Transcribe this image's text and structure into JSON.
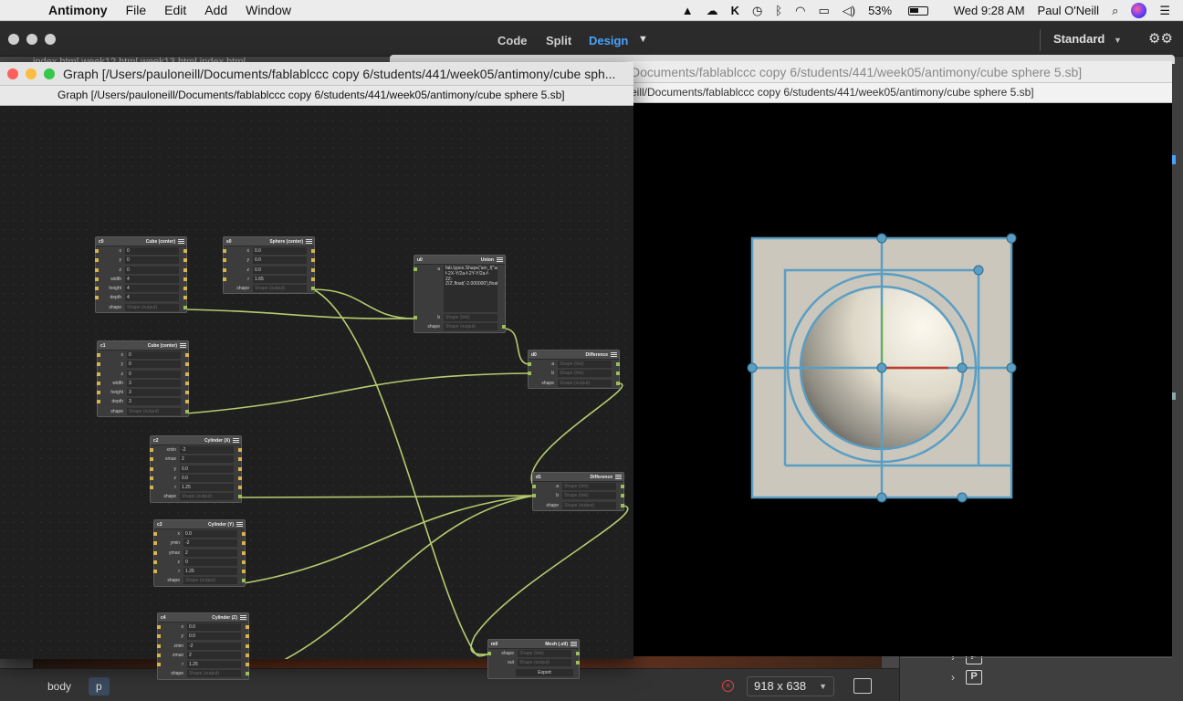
{
  "menubar": {
    "app": "Antimony",
    "items": [
      "File",
      "Edit",
      "Add",
      "Window"
    ],
    "battery": "53%",
    "clock": "Wed 9:28 AM",
    "user": "Paul O'Neill"
  },
  "dw": {
    "views": [
      "Code",
      "Split",
      "Design"
    ],
    "active_view": "Design",
    "workspace": "Standard",
    "tabs": "index.html          week12.html          week13.html          index.html"
  },
  "graph_window": {
    "title": "Graph [/Users/pauloneill/Documents/fablablccc copy 6/students/441/week05/antimony/cube sph...",
    "subtitle": "Graph [/Users/pauloneill/Documents/fablablccc copy 6/students/441/week05/antimony/cube sphere 5.sb]"
  },
  "view_window": {
    "title": "Documents/fablablccc copy 6/students/441/week05/antimony/cube sphere 5.sb]",
    "subtitle": "eill/Documents/fablablccc copy 6/students/441/week05/antimony/cube sphere 5.sb]"
  },
  "nodes": {
    "c0": {
      "id": "c0",
      "type": "Cube (center)",
      "rows": [
        [
          "x",
          "0"
        ],
        [
          "y",
          "0"
        ],
        [
          "z",
          "0"
        ],
        [
          "width",
          "4"
        ],
        [
          "height",
          "4"
        ],
        [
          "depth",
          "4"
        ],
        [
          "shape",
          "Shape (output)"
        ]
      ]
    },
    "s0": {
      "id": "s0",
      "type": "Sphere (center)",
      "rows": [
        [
          "x",
          "0.0"
        ],
        [
          "y",
          "0.0"
        ],
        [
          "z",
          "0.0"
        ],
        [
          "r",
          "1.65"
        ],
        [
          "shape",
          "Shape (output)"
        ]
      ]
    },
    "u0": {
      "id": "u0",
      "type": "Union",
      "a_label": "a",
      "expr": "fab.types.Shape('am_f(\"aa-f-2X-Y/2a-f-2Y-Y/2a-f-2Z-Z/2',float('-2.000000'),float('-2.000000'),float('-2.000000'),float('2.000000'),float('2.000000'),float('2.000000'))",
      "rows": [
        [
          "b",
          "Shape (link)"
        ],
        [
          "shape",
          "Shape (output)"
        ]
      ]
    },
    "c1": {
      "id": "c1",
      "type": "Cube (center)",
      "rows": [
        [
          "x",
          "0"
        ],
        [
          "y",
          "0"
        ],
        [
          "z",
          "0"
        ],
        [
          "width",
          "3"
        ],
        [
          "height",
          "3"
        ],
        [
          "depth",
          "3"
        ],
        [
          "shape",
          "Shape (output)"
        ]
      ]
    },
    "d0": {
      "id": "d0",
      "type": "Difference",
      "rows": [
        [
          "a",
          "Shape (link)"
        ],
        [
          "b",
          "Shape (link)"
        ],
        [
          "shape",
          "Shape (output)"
        ]
      ]
    },
    "c2": {
      "id": "c2",
      "type": "Cylinder (X)",
      "rows": [
        [
          "xmin",
          "-2"
        ],
        [
          "xmax",
          "2"
        ],
        [
          "y",
          "0.0"
        ],
        [
          "z",
          "0.0"
        ],
        [
          "r",
          "1.25"
        ],
        [
          "shape",
          "Shape (output)"
        ]
      ]
    },
    "d1": {
      "id": "d1",
      "type": "Difference",
      "rows": [
        [
          "a",
          "Shape (link)"
        ],
        [
          "b",
          "Shape (link)"
        ],
        [
          "shape",
          "Shape (output)"
        ]
      ]
    },
    "c3": {
      "id": "c3",
      "type": "Cylinder (Y)",
      "rows": [
        [
          "x",
          "0.0"
        ],
        [
          "ymin",
          "-2"
        ],
        [
          "ymax",
          "2"
        ],
        [
          "z",
          "0"
        ],
        [
          "r",
          "1.25"
        ],
        [
          "shape",
          "Shape (output)"
        ]
      ]
    },
    "c4": {
      "id": "c4",
      "type": "Cylinder (Z)",
      "rows": [
        [
          "x",
          "0.0"
        ],
        [
          "y",
          "0.0"
        ],
        [
          "zmin",
          "-2"
        ],
        [
          "zmax",
          "2"
        ],
        [
          "r",
          "1.25"
        ],
        [
          "shape",
          "Shape (output)"
        ]
      ]
    },
    "m0": {
      "id": "m0",
      "type": "Mesh (.stl)",
      "rows": [
        [
          "shape",
          "Shape (link)"
        ],
        [
          "out",
          "Shape (output)"
        ]
      ],
      "export": "Export"
    }
  },
  "statusbar": {
    "crumbs": [
      "body",
      "p"
    ],
    "viewport_size": "918 x 638"
  },
  "colors": {
    "wire": "#b5cc6e",
    "accent": "#4aa3ff",
    "handle": "#5a9ec4",
    "model_face": "#cbc7bd"
  }
}
